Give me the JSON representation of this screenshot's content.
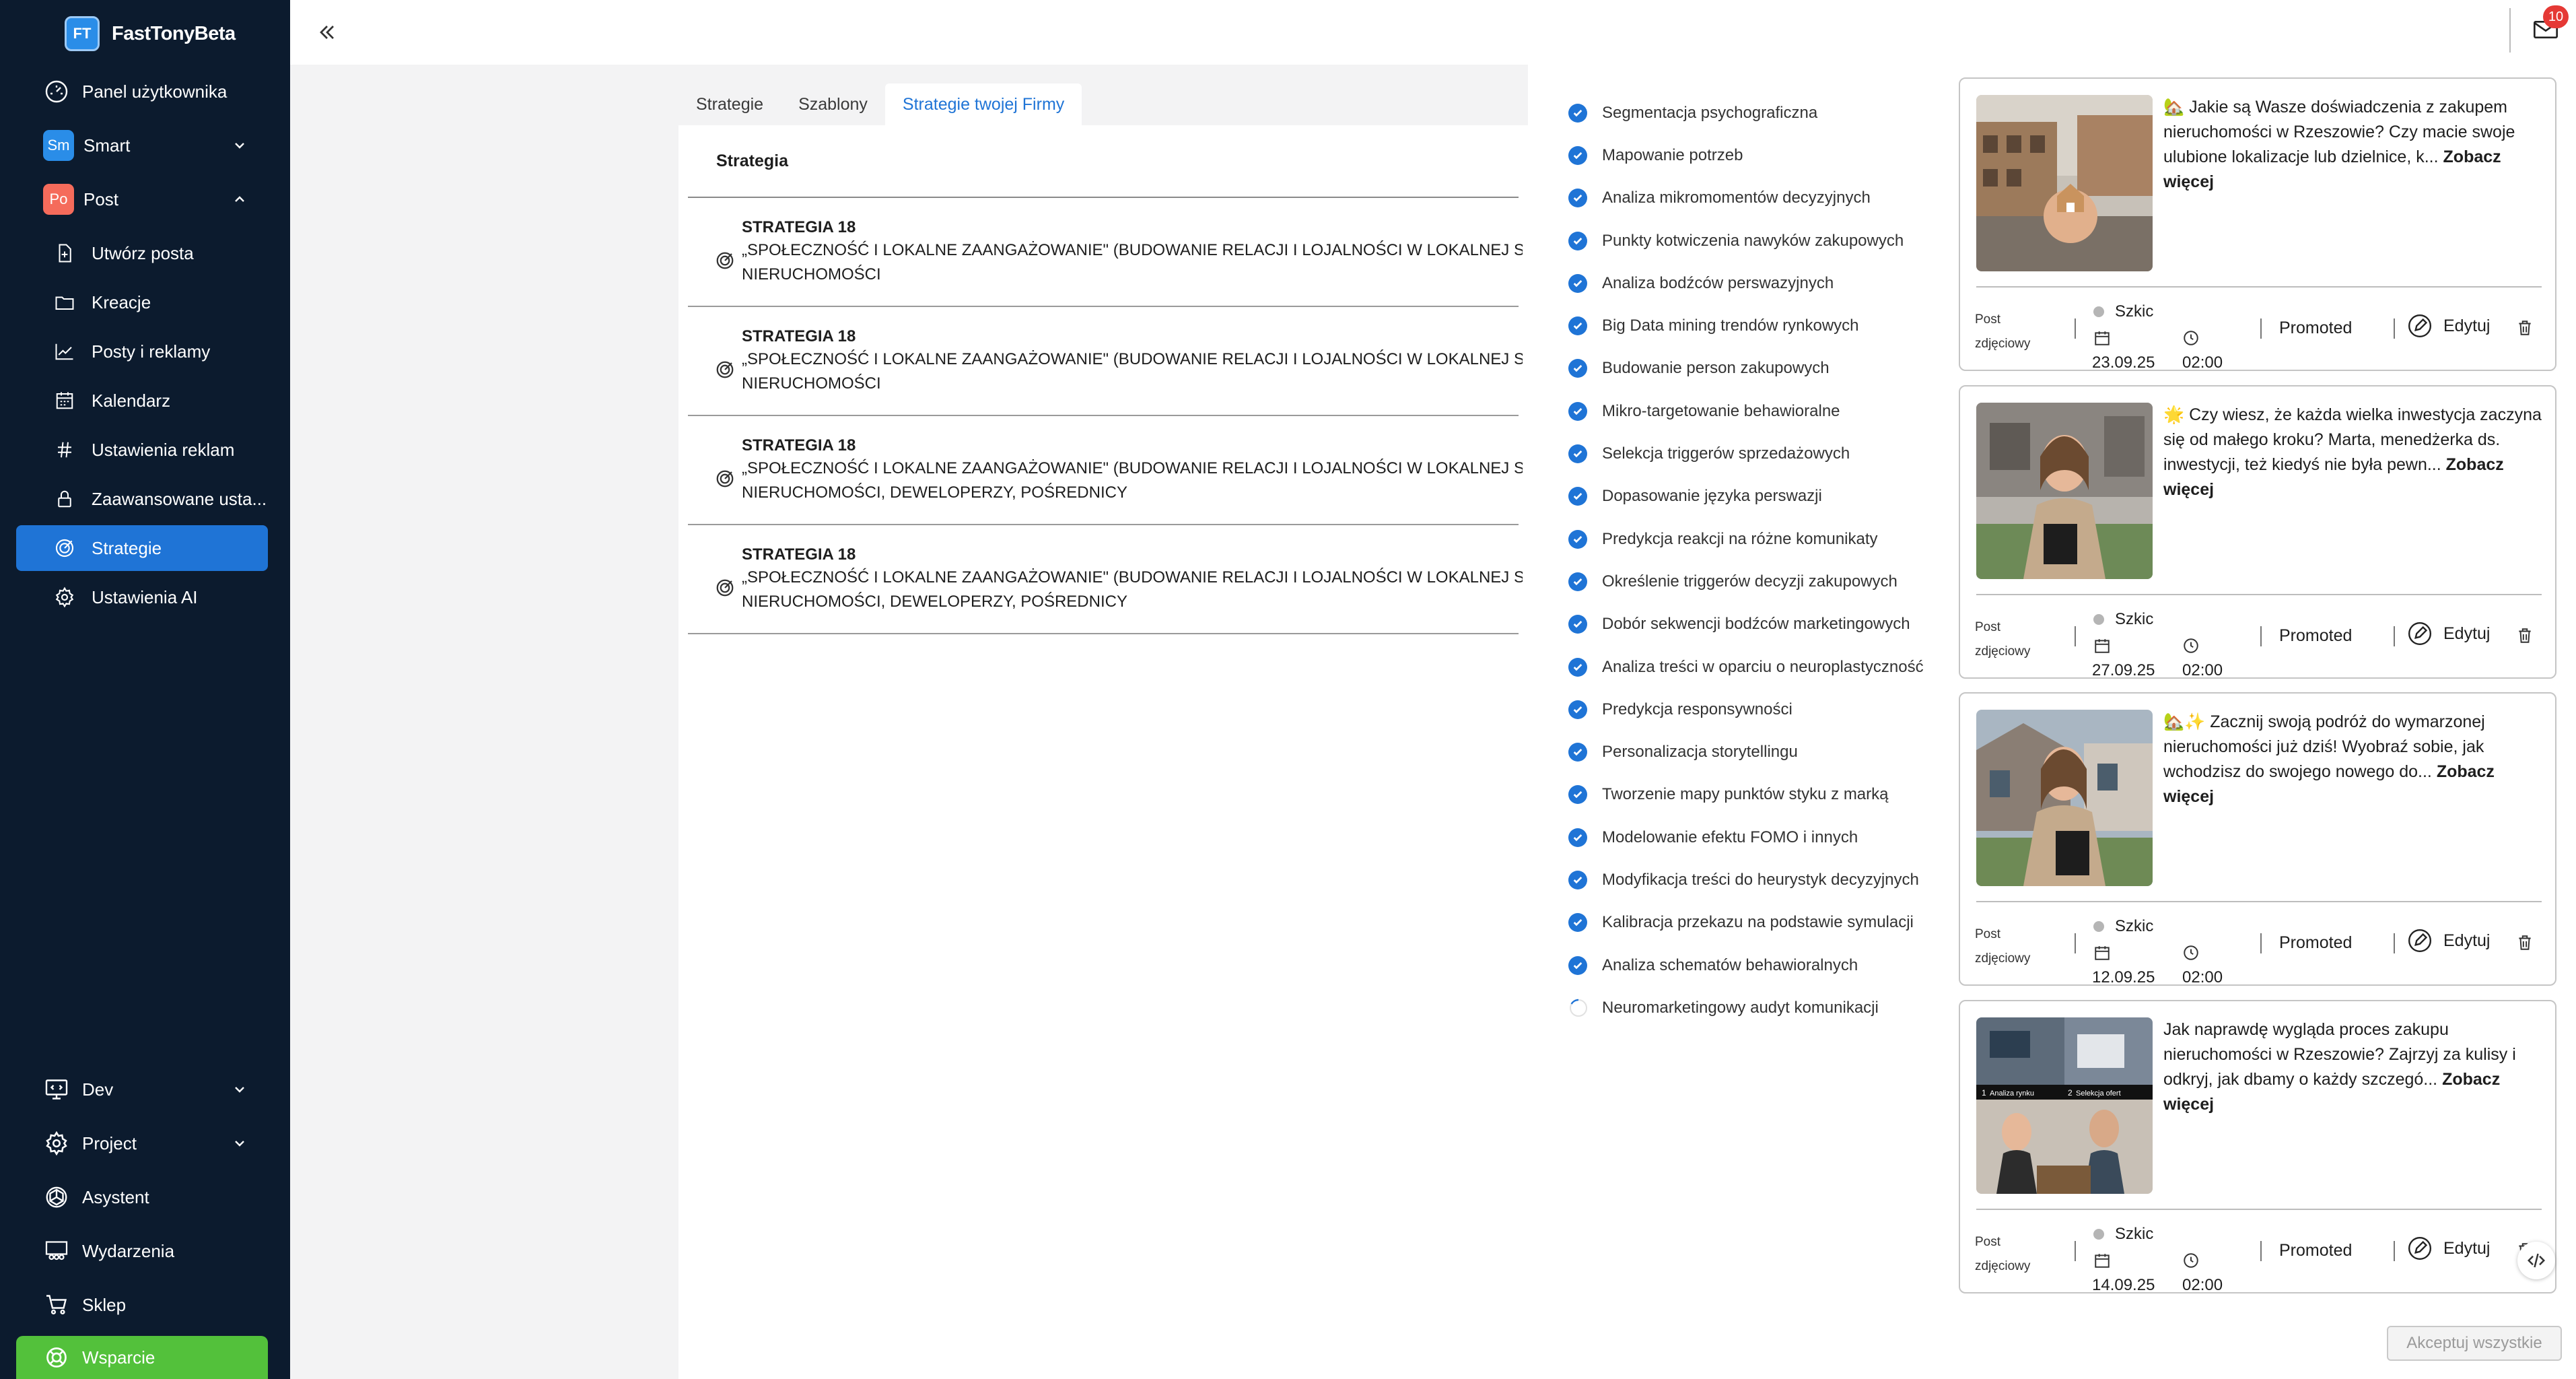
{
  "app": {
    "logo": "FT",
    "name": "FastTonyBeta"
  },
  "sidebar": {
    "items": [
      {
        "label": "Panel użytkownika",
        "icon": "gauge-icon"
      },
      {
        "label": "Smart",
        "badge": "Sm",
        "badge_color": "#2a8de8"
      },
      {
        "label": "Post",
        "badge": "Po",
        "badge_color": "#f56b5b"
      },
      {
        "label": "Utwórz posta",
        "icon": "file-plus-icon"
      },
      {
        "label": "Kreacje",
        "icon": "folder-icon"
      },
      {
        "label": "Posty i reklamy",
        "icon": "chart-line-icon"
      },
      {
        "label": "Kalendarz",
        "icon": "calendar-icon"
      },
      {
        "label": "Ustawienia reklam",
        "icon": "hash-icon"
      },
      {
        "label": "Zaawansowane usta...",
        "icon": "lock-icon"
      },
      {
        "label": "Strategie",
        "icon": "target-icon"
      },
      {
        "label": "Ustawienia AI",
        "icon": "gear-icon"
      },
      {
        "label": "Dev",
        "icon": "monitor-icon"
      },
      {
        "label": "Project",
        "icon": "gear-icon"
      },
      {
        "label": "Asystent",
        "icon": "openai-icon"
      },
      {
        "label": "Wydarzenia",
        "icon": "users-icon"
      },
      {
        "label": "Sklep",
        "icon": "cart-icon"
      },
      {
        "label": "Wsparcie",
        "icon": "support-icon"
      }
    ]
  },
  "tabs": [
    "Strategie",
    "Szablony",
    "Strategie twojej Firmy"
  ],
  "table": {
    "header": "Strategia",
    "rows": [
      {
        "title": "STRATEGIA 18",
        "line1": "„SPOŁECZNOŚĆ I LOKALNE ZAANGAŻOWANIE\" (BUDOWANIE RELACJI I LOJALNOŚCI W LOKALNEJ SPOŁ",
        "line2": "NIERUCHOMOŚCI"
      },
      {
        "title": "STRATEGIA 18",
        "line1": "„SPOŁECZNOŚĆ I LOKALNE ZAANGAŻOWANIE\" (BUDOWANIE RELACJI I LOJALNOŚCI W LOKALNEJ SPOŁ",
        "line2": "NIERUCHOMOŚCI"
      },
      {
        "title": "STRATEGIA 18",
        "line1": "„SPOŁECZNOŚĆ I LOKALNE ZAANGAŻOWANIE\" (BUDOWANIE RELACJI I LOJALNOŚCI W LOKALNEJ SPOŁ",
        "line2": "NIERUCHOMOŚCI, DEWELOPERZY, POŚREDNICY"
      },
      {
        "title": "STRATEGIA 18",
        "line1": "„SPOŁECZNOŚĆ I LOKALNE ZAANGAŻOWANIE\" (BUDOWANIE RELACJI I LOJALNOŚCI W LOKALNEJ SPOŁ",
        "line2": "NIERUCHOMOŚCI, DEWELOPERZY, POŚREDNICY"
      }
    ]
  },
  "steps": [
    "Segmentacja psychograficzna",
    "Mapowanie potrzeb",
    "Analiza mikromomentów decyzyjnych",
    "Punkty kotwiczenia nawyków zakupowych",
    "Analiza bodźców perswazyjnych",
    "Big Data mining trendów rynkowych",
    "Budowanie person zakupowych",
    "Mikro-targetowanie behawioralne",
    "Selekcja triggerów sprzedażowych",
    "Dopasowanie języka perswazji",
    "Predykcja reakcji na różne komunikaty",
    "Określenie triggerów decyzji zakupowych",
    "Dobór sekwencji bodźców marketingowych",
    "Analiza treści w oparciu o neuroplastyczność",
    "Predykcja responsywności",
    "Personalizacja storytellingu",
    "Tworzenie mapy punktów styku z marką",
    "Modelowanie efektu FOMO i innych",
    "Modyfikacja treści do heurystyk decyzyjnych",
    "Kalibracja przekazu na podstawie symulacji",
    "Analiza schematów behawioralnych"
  ],
  "step_in_progress": "Neuromarketingowy audyt komunikacji",
  "cards": [
    {
      "text": "🏡 Jakie są Wasze doświadczenia z zakupem nieruchomości w Rzeszowie? Czy macie swoje ulubione lokalizacje lub dzielnice, k...",
      "more": "Zobacz więcej",
      "type": "Post zdjęciowy",
      "status": "Szkic",
      "date": "23.09.25",
      "time": "02:00",
      "promo": "Promoted",
      "edit": "Edytuj",
      "image": "keys-house-photo"
    },
    {
      "text": "🌟 Czy wiesz, że każda wielka inwestycja zaczyna się od małego kroku? Marta, menedżerka ds. inwestycji, też kiedyś nie była pewn...",
      "more": "Zobacz więcej",
      "type": "Post zdjęciowy",
      "status": "Szkic",
      "date": "27.09.25",
      "time": "02:00",
      "promo": "Promoted",
      "edit": "Edytuj",
      "image": "woman-portrait-photo"
    },
    {
      "text": "🏡✨ Zacznij swoją podróż do wymarzonej nieruchomości już dziś! Wyobraź sobie, jak wchodzisz do swojego nowego do...",
      "more": "Zobacz więcej",
      "type": "Post zdjęciowy",
      "status": "Szkic",
      "date": "12.09.25",
      "time": "02:00",
      "promo": "Promoted",
      "edit": "Edytuj",
      "image": "woman-house-photo"
    },
    {
      "text": "Jak naprawdę wygląda proces zakupu nieruchomości w Rzeszowie? Zajrzyj za kulisy i odkryj, jak dbamy o każdy szczegó...",
      "more": "Zobacz więcej",
      "type": "Post zdjęciowy",
      "status": "Szkic",
      "date": "14.09.25",
      "time": "02:00",
      "promo": "Promoted",
      "edit": "Edytuj",
      "image": "collage-photo",
      "collage_labels": [
        "1",
        "Analiza rynku",
        "2",
        "Selekcja ofert"
      ]
    }
  ],
  "accept_all": "Akceptuj wszystkie",
  "notifications": {
    "count": "10"
  }
}
